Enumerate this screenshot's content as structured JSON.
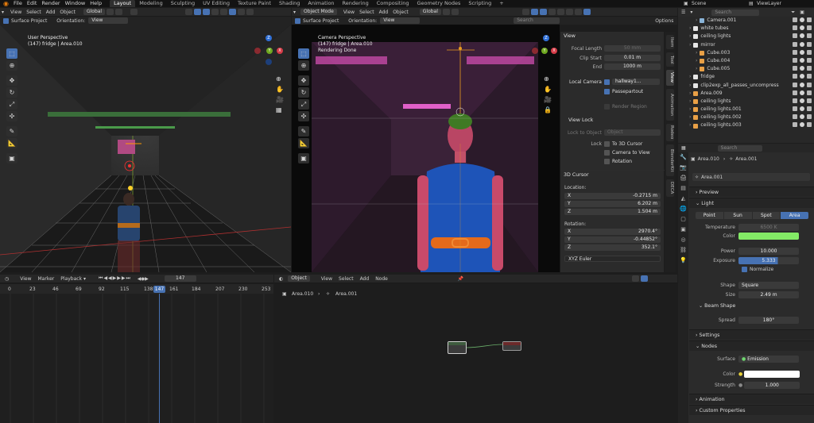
{
  "menubar": {
    "items": [
      "File",
      "Edit",
      "Render",
      "Window",
      "Help"
    ],
    "workspaces": [
      "Layout",
      "Modeling",
      "Sculpting",
      "UV Editing",
      "Texture Paint",
      "Shading",
      "Animation",
      "Rendering",
      "Compositing",
      "Geometry Nodes",
      "Scripting"
    ],
    "plus": "+",
    "scene": "Scene",
    "view_layer": "ViewLayer"
  },
  "left_vp": {
    "menus": [
      "View",
      "Select",
      "Add",
      "Object"
    ],
    "orientation": "Global",
    "surface_project": "Surface Project",
    "orientation_label": "Orientation:",
    "orientation_value": "View",
    "title": "User Perspective",
    "subtitle": "(147) fridge | Area.010"
  },
  "mid_vp": {
    "mode": "Object Mode",
    "menus": [
      "View",
      "Select",
      "Add",
      "Object"
    ],
    "orientation": "Global",
    "surface_project": "Surface Project",
    "orientation_label": "Orientation:",
    "orientation_value": "View",
    "search_placeholder": "Search",
    "options": "Options",
    "title": "Camera Perspective",
    "subtitle": "(147) fridge | Area.010",
    "status": "Rendering Done"
  },
  "npanel": {
    "view_header": "View",
    "focal_label": "Focal Length",
    "focal": "50 mm",
    "clip_start_label": "Clip Start",
    "clip_start": "0.01 m",
    "end_label": "End",
    "end": "1000 m",
    "local_camera_label": "Local Camera",
    "local_camera": "hallway1...",
    "passepartout": "Passepartout",
    "render_region": "Render Region",
    "view_lock": "View Lock",
    "lock_to_object_label": "Lock to Object",
    "lock_to_object": "Object",
    "lock_label": "Lock",
    "to_3d_cursor": "To 3D Cursor",
    "camera_to_view": "Camera to View",
    "rotation_chk": "Rotation",
    "cursor_header": "3D Cursor",
    "location_label": "Location:",
    "x": "X",
    "y": "Y",
    "z": "Z",
    "loc_x": "-0.2715 m",
    "loc_y": "6.202 m",
    "loc_z": "1.504 m",
    "rotation_label": "Rotation:",
    "rot_x": "2970.4°",
    "rot_y": "-0.44852°",
    "rot_z": "352.1°",
    "euler": "XYZ Euler",
    "tabs": [
      "Item",
      "Tool",
      "View",
      "Animation",
      "Rodeo",
      "BlenderKit",
      "DECA"
    ]
  },
  "timeline": {
    "menus": [
      "View",
      "Marker",
      "Playback"
    ],
    "frame": "147",
    "ticks": [
      "0",
      "23",
      "46",
      "69",
      "92",
      "115",
      "138",
      "161",
      "184",
      "207",
      "230",
      "253"
    ],
    "current": "147"
  },
  "node_editor": {
    "mode": "Object",
    "menus": [
      "View",
      "Select",
      "Add",
      "Node"
    ],
    "breadcrumb": [
      "Area.010",
      "Area.001"
    ]
  },
  "outliner": {
    "search_placeholder": "Search",
    "rows": [
      {
        "name": "Camera.001",
        "indent": 2,
        "color": "#8ab4d8"
      },
      {
        "name": "white tubes",
        "indent": 1,
        "color": "#e6e6e6"
      },
      {
        "name": "ceiling lights",
        "indent": 1,
        "color": "#e6e6e6"
      },
      {
        "name": "mirror",
        "indent": 1,
        "color": "#e6e6e6"
      },
      {
        "name": "Cube.003",
        "indent": 2,
        "color": "#e9a046"
      },
      {
        "name": "Cube.004",
        "indent": 2,
        "color": "#e9a046"
      },
      {
        "name": "Cube.005",
        "indent": 2,
        "color": "#e9a046"
      },
      {
        "name": "fridge",
        "indent": 1,
        "color": "#e6e6e6"
      },
      {
        "name": "clip2exp_all_passes_uncompress",
        "indent": 1,
        "color": "#e6e6e6"
      },
      {
        "name": "Area.009",
        "indent": 1,
        "color": "#e9a046"
      },
      {
        "name": "ceiling lights",
        "indent": 1,
        "color": "#e9a046"
      },
      {
        "name": "ceiling lights.001",
        "indent": 1,
        "color": "#e9a046"
      },
      {
        "name": "ceiling lights.002",
        "indent": 1,
        "color": "#e9a046"
      },
      {
        "name": "ceiling lights.003",
        "indent": 1,
        "color": "#e9a046"
      }
    ]
  },
  "properties": {
    "search_placeholder": "Search",
    "breadcrumb": [
      "Area.010",
      "Area.001"
    ],
    "data_name": "Area.001",
    "preview": "Preview",
    "light": "Light",
    "light_types": [
      "Point",
      "Sun",
      "Spot",
      "Area"
    ],
    "active_type": "Area",
    "temperature_label": "Temperature",
    "temperature": "6500 K",
    "color_label": "Color",
    "light_color": "#83ea66",
    "power_label": "Power",
    "power": "10.000",
    "exposure_label": "Exposure",
    "exposure": "5.333",
    "normalize": "Normalize",
    "shape_label": "Shape",
    "shape": "Square",
    "size_label": "Size",
    "size": "2.49 m",
    "beam_shape": "Beam Shape",
    "spread_label": "Spread",
    "spread": "180°",
    "settings": "Settings",
    "nodes": "Nodes",
    "surface_label": "Surface",
    "surface": "Emission",
    "node_color_label": "Color",
    "node_color": "#ffffff",
    "strength_label": "Strength",
    "strength": "1.000",
    "animation": "Animation",
    "custom_properties": "Custom Properties"
  }
}
